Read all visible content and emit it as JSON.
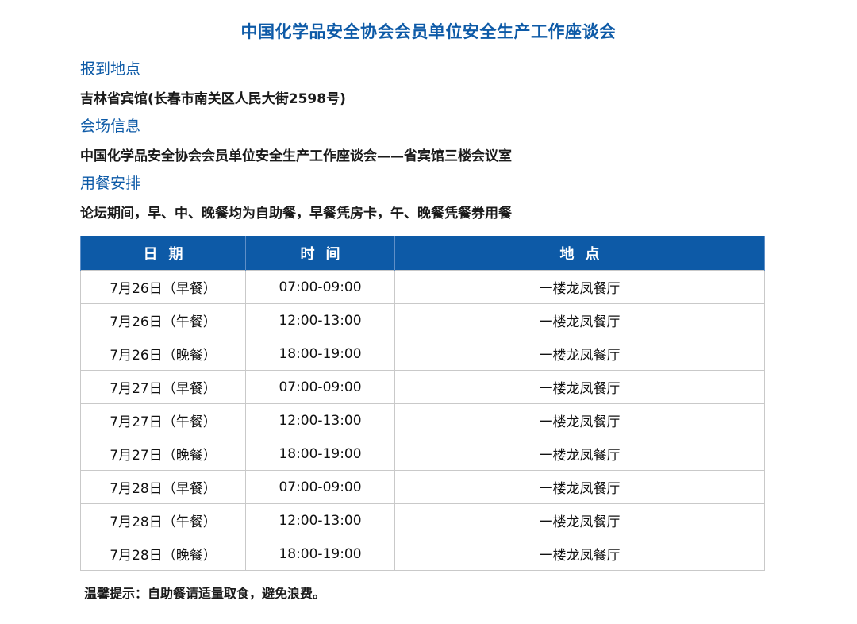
{
  "title": "中国化学品安全协会会员单位安全生产工作座谈会",
  "sections": {
    "venue": {
      "heading": "报到地点",
      "text": "吉林省宾馆(长春市南关区人民大街2598号)"
    },
    "hall": {
      "heading": "会场信息",
      "text": "中国化学品安全协会会员单位安全生产工作座谈会——省宾馆三楼会议室"
    },
    "meal": {
      "heading": "用餐安排",
      "text": "论坛期间，早、中、晚餐均为自助餐，早餐凭房卡，午、晚餐凭餐券用餐"
    }
  },
  "table": {
    "header_color": "#0d5aa7",
    "headers": [
      "日期",
      "时间",
      "地点"
    ],
    "rows": [
      [
        "7月26日（早餐）",
        "07:00-09:00",
        "一楼龙凤餐厅"
      ],
      [
        "7月26日（午餐）",
        "12:00-13:00",
        "一楼龙凤餐厅"
      ],
      [
        "7月26日（晚餐）",
        "18:00-19:00",
        "一楼龙凤餐厅"
      ],
      [
        "7月27日（早餐）",
        "07:00-09:00",
        "一楼龙凤餐厅"
      ],
      [
        "7月27日（午餐）",
        "12:00-13:00",
        "一楼龙凤餐厅"
      ],
      [
        "7月27日（晚餐）",
        "18:00-19:00",
        "一楼龙凤餐厅"
      ],
      [
        "7月28日（早餐）",
        "07:00-09:00",
        "一楼龙凤餐厅"
      ],
      [
        "7月28日（午餐）",
        "12:00-13:00",
        "一楼龙凤餐厅"
      ],
      [
        "7月28日（晚餐）",
        "18:00-19:00",
        "一楼龙凤餐厅"
      ]
    ]
  },
  "footer_note": "温馨提示：自助餐请适量取食，避免浪费。"
}
